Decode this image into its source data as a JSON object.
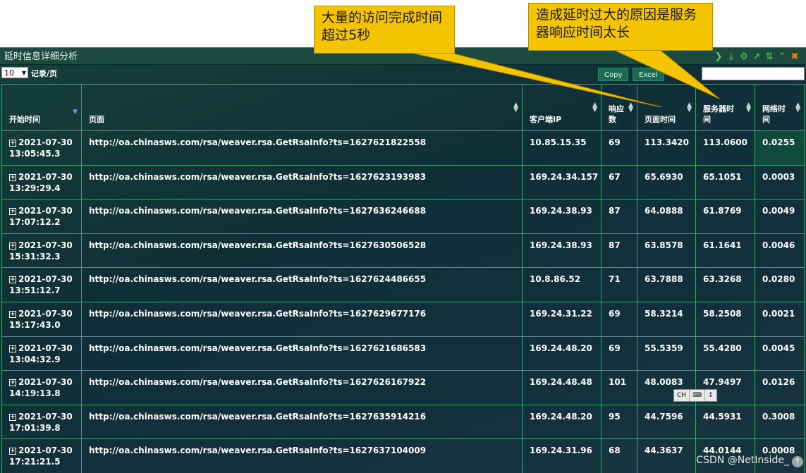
{
  "annotations": {
    "callout_1": "大量的访问完成时间超过5秒",
    "callout_2": "造成延时过大的原因是服务器响应时间太长"
  },
  "panel": {
    "title": "延时信息详细分析",
    "toolbar_icons": [
      "chevron-right-icon",
      "download-icon",
      "settings-icon",
      "chart-icon",
      "sort-icon",
      "collapse-icon",
      "close-icon"
    ],
    "colors": {
      "background": "#12303c",
      "border": "#3aa172",
      "toolbar_icon": "#5cd35c",
      "close_icon": "#ff7b1a"
    }
  },
  "controls": {
    "page_size": "10",
    "per_page_label": "记录/页",
    "copy_label": "Copy",
    "excel_label": "Excel",
    "search_value": ""
  },
  "table": {
    "columns": [
      "开始时间",
      "页面",
      "客户端IP",
      "响应数",
      "页面时间",
      "服务器时间",
      "网络时间"
    ],
    "rows": [
      {
        "start_time_date": "2021-07-30",
        "start_time_clock": "13:05:45.3",
        "page": "http://oa.chinasws.com/rsa/weaver.rsa.GetRsaInfo?ts=1627621822558",
        "ip": "10.85.15.35",
        "count": "69",
        "page_time": "113.3420",
        "server_time": "113.0600",
        "network_time": "0.0255"
      },
      {
        "start_time_date": "2021-07-30",
        "start_time_clock": "13:29:29.4",
        "page": "http://oa.chinasws.com/rsa/weaver.rsa.GetRsaInfo?ts=1627623193983",
        "ip": "169.24.34.157",
        "count": "67",
        "page_time": "65.6930",
        "server_time": "65.1051",
        "network_time": "0.0003"
      },
      {
        "start_time_date": "2021-07-30",
        "start_time_clock": "17:07:12.2",
        "page": "http://oa.chinasws.com/rsa/weaver.rsa.GetRsaInfo?ts=1627636246688",
        "ip": "169.24.38.93",
        "count": "87",
        "page_time": "64.0888",
        "server_time": "61.8769",
        "network_time": "0.0049"
      },
      {
        "start_time_date": "2021-07-30",
        "start_time_clock": "15:31:32.3",
        "page": "http://oa.chinasws.com/rsa/weaver.rsa.GetRsaInfo?ts=1627630506528",
        "ip": "169.24.38.93",
        "count": "87",
        "page_time": "63.8578",
        "server_time": "61.1641",
        "network_time": "0.0046"
      },
      {
        "start_time_date": "2021-07-30",
        "start_time_clock": "13:51:12.7",
        "page": "http://oa.chinasws.com/rsa/weaver.rsa.GetRsaInfo?ts=1627624486655",
        "ip": "10.8.86.52",
        "count": "71",
        "page_time": "63.7888",
        "server_time": "63.3268",
        "network_time": "0.0280"
      },
      {
        "start_time_date": "2021-07-30",
        "start_time_clock": "15:17:43.0",
        "page": "http://oa.chinasws.com/rsa/weaver.rsa.GetRsaInfo?ts=1627629677176",
        "ip": "169.24.31.22",
        "count": "69",
        "page_time": "58.3214",
        "server_time": "58.2508",
        "network_time": "0.0021"
      },
      {
        "start_time_date": "2021-07-30",
        "start_time_clock": "13:04:32.9",
        "page": "http://oa.chinasws.com/rsa/weaver.rsa.GetRsaInfo?ts=1627621686583",
        "ip": "169.24.48.20",
        "count": "69",
        "page_time": "55.5359",
        "server_time": "55.4280",
        "network_time": "0.0045"
      },
      {
        "start_time_date": "2021-07-30",
        "start_time_clock": "14:19:13.8",
        "page": "http://oa.chinasws.com/rsa/weaver.rsa.GetRsaInfo?ts=1627626167922",
        "ip": "169.24.48.48",
        "count": "101",
        "page_time": "48.0083",
        "server_time": "47.9497",
        "network_time": "0.0126"
      },
      {
        "start_time_date": "2021-07-30",
        "start_time_clock": "17:01:39.8",
        "page": "http://oa.chinasws.com/rsa/weaver.rsa.GetRsaInfo?ts=1627635914216",
        "ip": "169.24.48.20",
        "count": "95",
        "page_time": "44.7596",
        "server_time": "44.5931",
        "network_time": "0.3008"
      },
      {
        "start_time_date": "2021-07-30",
        "start_time_clock": "17:21:21.5",
        "page": "http://oa.chinasws.com/rsa/weaver.rsa.GetRsaInfo?ts=1627637104009",
        "ip": "169.24.31.96",
        "count": "68",
        "page_time": "44.3637",
        "server_time": "44.0144",
        "network_time": "0.0008"
      }
    ]
  },
  "ime_widget": {
    "label": "CH"
  },
  "watermark": "CSDN @NetInside_"
}
